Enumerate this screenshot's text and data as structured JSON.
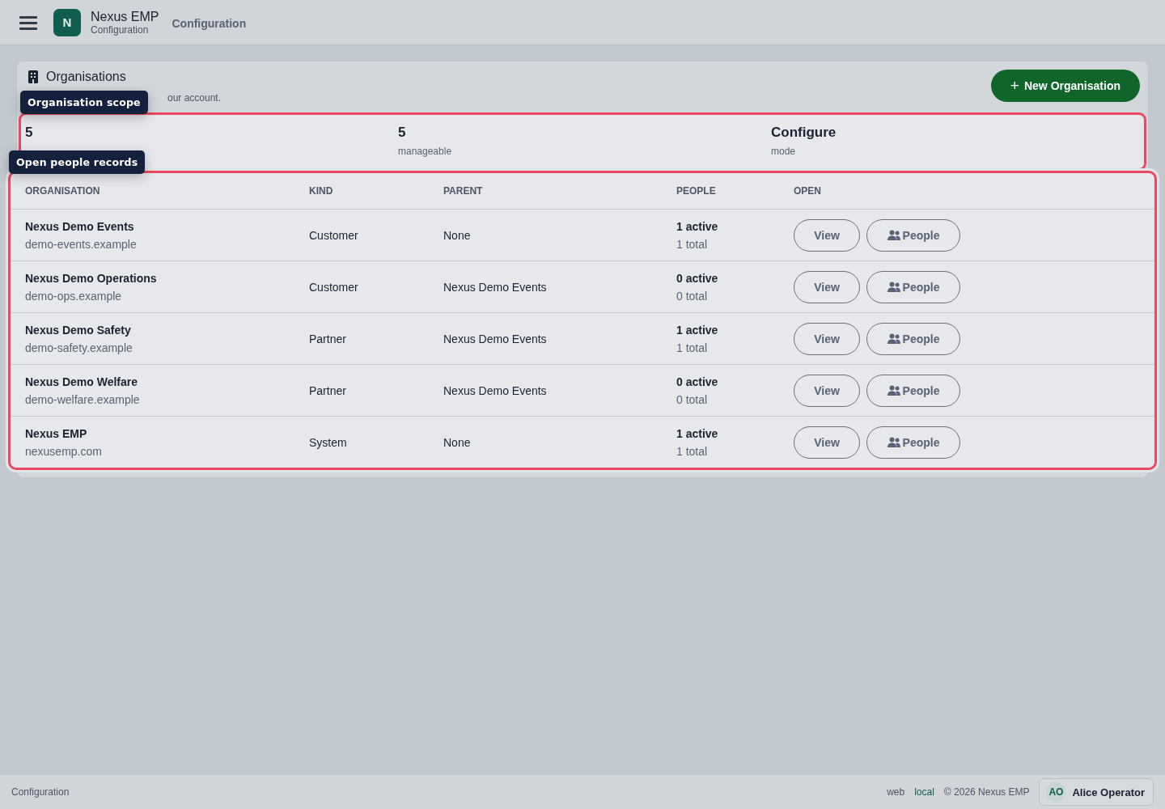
{
  "header": {
    "app_name": "Nexus EMP",
    "app_subtitle": "Configuration",
    "logo_letter": "N",
    "page_title": "Configuration"
  },
  "card": {
    "title": "Organisations",
    "description": "our account.",
    "action": "New Organisation",
    "action_icon": "+"
  },
  "stats": {
    "highlighted": true,
    "items": [
      {
        "value": "5"
      },
      {
        "value": "5",
        "label": "manageable"
      },
      {
        "value": "Configure",
        "label": "mode"
      }
    ]
  },
  "table": {
    "highlighted": true,
    "columns": [
      "ORGANISATION",
      "KIND",
      "PARENT",
      "PEOPLE",
      "OPEN"
    ],
    "rows": [
      {
        "name": "Nexus Demo Events",
        "domain": "demo-events.example",
        "kind": "Customer",
        "parent": "None",
        "active": "1 active",
        "total": "1 total",
        "view": "View",
        "people": "People"
      },
      {
        "name": "Nexus Demo Operations",
        "domain": "demo-ops.example",
        "kind": "Customer",
        "parent": "Nexus Demo Events",
        "active": "0 active",
        "total": "0 total",
        "view": "View",
        "people": "People"
      },
      {
        "name": "Nexus Demo Safety",
        "domain": "demo-safety.example",
        "kind": "Partner",
        "parent": "Nexus Demo Events",
        "active": "1 active",
        "total": "1 total",
        "view": "View",
        "people": "People"
      },
      {
        "name": "Nexus Demo Welfare",
        "domain": "demo-welfare.example",
        "kind": "Partner",
        "parent": "Nexus Demo Events",
        "active": "0 active",
        "total": "0 total",
        "view": "View",
        "people": "People"
      },
      {
        "name": "Nexus EMP",
        "domain": "nexusemp.com",
        "kind": "System",
        "parent": "None",
        "active": "1 active",
        "total": "1 total",
        "view": "View",
        "people": "People"
      }
    ]
  },
  "tour": [
    {
      "label": "Organisation scope"
    },
    {
      "label": "Open people records"
    }
  ],
  "footer": {
    "page": "Configuration",
    "channel": "web",
    "environment": "local",
    "copyright": "© 2026 Nexus EMP",
    "user": {
      "initials": "AO",
      "name": "Alice Operator"
    }
  }
}
